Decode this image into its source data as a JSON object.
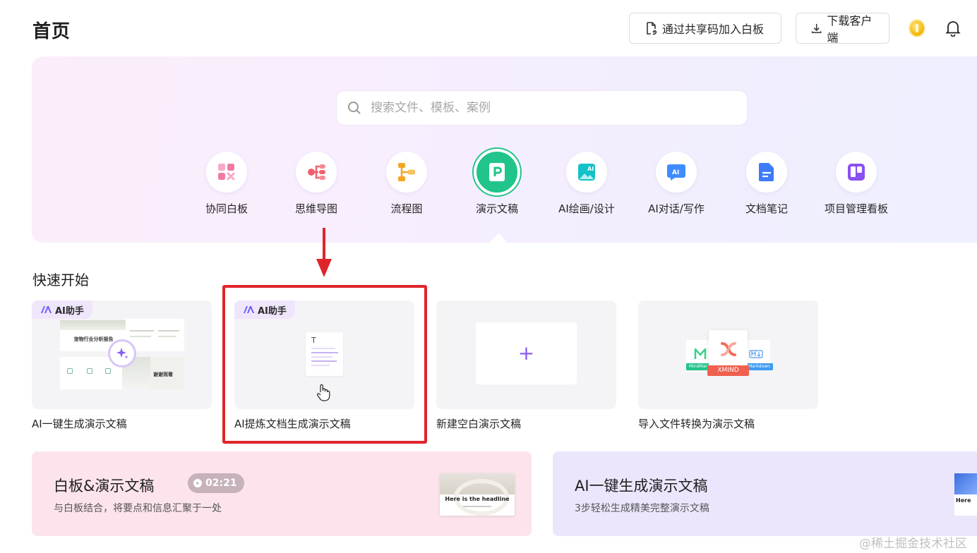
{
  "header": {
    "title": "首页",
    "join_label": "通过共享码加入白板",
    "download_label": "下载客户端"
  },
  "hero": {
    "search_placeholder": "搜索文件、模板、案例",
    "categories": [
      {
        "label": "协同白板",
        "icon": "whiteboard-icon",
        "color": "#f08fb5"
      },
      {
        "label": "思维导图",
        "icon": "mindmap-icon",
        "color": "#f0606e"
      },
      {
        "label": "流程图",
        "icon": "flowchart-icon",
        "color": "#f5a524"
      },
      {
        "label": "演示文稿",
        "icon": "presentation-icon",
        "color": "#21c48a",
        "active": true
      },
      {
        "label": "AI绘画/设计",
        "icon": "ai-painting-icon",
        "color": "#14c1c9"
      },
      {
        "label": "AI对话/写作",
        "icon": "ai-chat-icon",
        "color": "#3f8cff"
      },
      {
        "label": "文档笔记",
        "icon": "document-icon",
        "color": "#3d7bfa"
      },
      {
        "label": "项目管理看板",
        "icon": "kanban-icon",
        "color": "#8a50f0"
      }
    ]
  },
  "quick_start": {
    "title": "快速开始",
    "ai_badge": "AI助手",
    "cards": [
      {
        "caption": "AI一键生成演示文稿",
        "badge": true,
        "thumb_text_a": "宠物行业分析报告",
        "thumb_text_b": "谢谢观看"
      },
      {
        "caption": "AI提炼文档生成演示文稿",
        "badge": true,
        "doc_icon_letter": "T"
      },
      {
        "caption": "新建空白演示文稿",
        "badge": false,
        "plus": "+"
      },
      {
        "caption": "导入文件转换为演示文稿",
        "badge": false,
        "formats": [
          "MindMan",
          "XMIND",
          "Markdown"
        ]
      }
    ]
  },
  "banners": [
    {
      "title": "白板&演示文稿",
      "subtitle": "与白板结合，将要点和信息汇聚于一处",
      "duration": "02:21",
      "thumb_headline": "Here is the headline"
    },
    {
      "title": "AI一键生成演示文稿",
      "subtitle": "3步轻松生成精美完整演示文稿",
      "thumb_headline": "Here"
    }
  ],
  "watermark": "@稀土掘金技术社区",
  "colors": {
    "accent_green": "#21c48a",
    "highlight_red": "#e0242b",
    "ai_purple": "#8a5cf6"
  }
}
